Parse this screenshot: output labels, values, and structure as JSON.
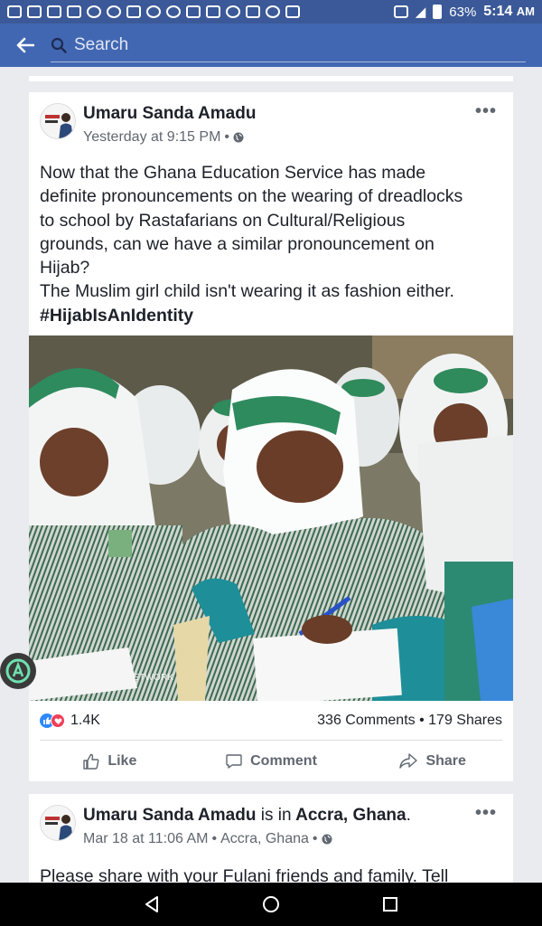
{
  "status_bar": {
    "battery": "63%",
    "time": "5:14",
    "time_suffix": "AM"
  },
  "search": {
    "placeholder": "Search"
  },
  "post1": {
    "author": "Umaru Sanda Amadu",
    "timestamp": "Yesterday at 9:15 PM",
    "text_lines": [
      "Now that the Ghana Education Service has made",
      "definite pronouncements on the wearing of dreadlocks",
      "to school by Rastafarians on Cultural/Religious",
      "grounds, can we have a similar pronouncement on",
      "Hijab?",
      "The Muslim girl child isn't wearing it as fashion either."
    ],
    "hashtag": "#HijabIsAnIdentity",
    "photo_caption": "LIMAH MENTORSHIP NETWORK",
    "reactions_count": "1.4K",
    "comments": "336 Comments",
    "shares": "179 Shares",
    "actions": {
      "like": "Like",
      "comment": "Comment",
      "share": "Share"
    }
  },
  "post2": {
    "author": "Umaru Sanda Amadu",
    "is_in": "is in",
    "location": "Accra, Ghana",
    "timestamp": "Mar 18 at 11:06 AM",
    "place": "Accra, Ghana",
    "text_partial": "Please share with your Fulani friends and family. Tell"
  },
  "colors": {
    "status_bar": "#3b5998",
    "search_bar": "#4267b2",
    "feed_bg": "#e9ebee",
    "like_blue": "#2d88ff",
    "love_red": "#f33e58"
  },
  "icons": [
    "back-arrow-icon",
    "search-icon",
    "globe-icon",
    "more-icon",
    "like-icon",
    "comment-icon",
    "share-icon",
    "nav-back-icon",
    "nav-home-icon",
    "nav-recents-icon"
  ]
}
